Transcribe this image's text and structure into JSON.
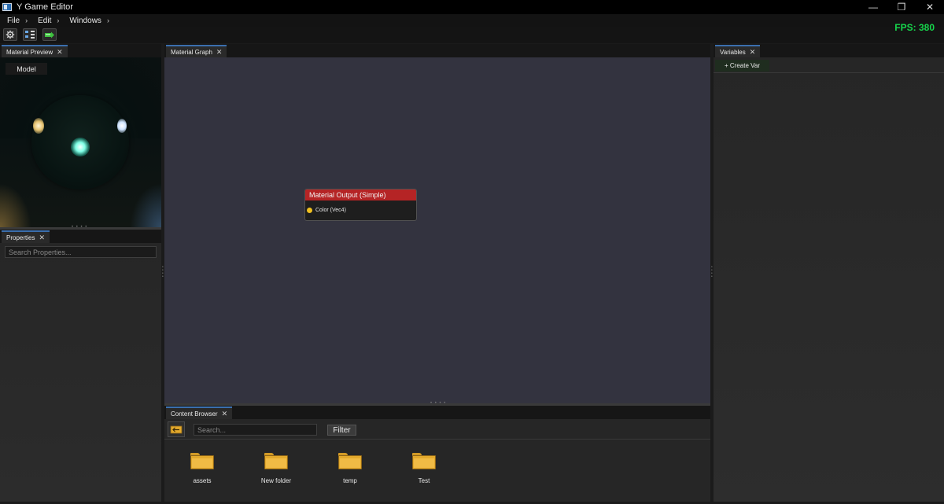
{
  "window": {
    "title": "Y Game Editor",
    "controls": {
      "minimize": "—",
      "restore": "❐",
      "close": "✕"
    }
  },
  "menu": {
    "items": [
      {
        "label": "File",
        "chevron": "›"
      },
      {
        "label": "Edit",
        "chevron": "›"
      },
      {
        "label": "Windows",
        "chevron": "›"
      }
    ]
  },
  "toolbar": {
    "buttons": [
      "gear-icon",
      "hierarchy-icon",
      "play-icon"
    ]
  },
  "fps": {
    "label": "FPS: 380"
  },
  "material_preview": {
    "tab_label": "Material Preview",
    "close": "✕",
    "model_button": "Model"
  },
  "properties": {
    "tab_label": "Properties",
    "close": "✕",
    "search_placeholder": "Search Properties..."
  },
  "material_graph": {
    "tab_label": "Material Graph",
    "close": "✕",
    "node": {
      "title": "Material Output (Simple)",
      "pin_label": "Color (Vec4)",
      "header_color": "#b52425",
      "pin_color": "#f0c020"
    }
  },
  "variables": {
    "tab_label": "Variables",
    "close": "✕",
    "create_button": "+ Create Var"
  },
  "content_browser": {
    "tab_label": "Content Browser",
    "close": "✕",
    "search_placeholder": "Search...",
    "filter_button": "Filter",
    "folders": [
      {
        "name": "assets"
      },
      {
        "name": "New folder"
      },
      {
        "name": "temp"
      },
      {
        "name": "Test"
      }
    ]
  },
  "colors": {
    "accent": "#3b6fae",
    "fps": "#16d64c",
    "folder": "#e3a92c"
  }
}
